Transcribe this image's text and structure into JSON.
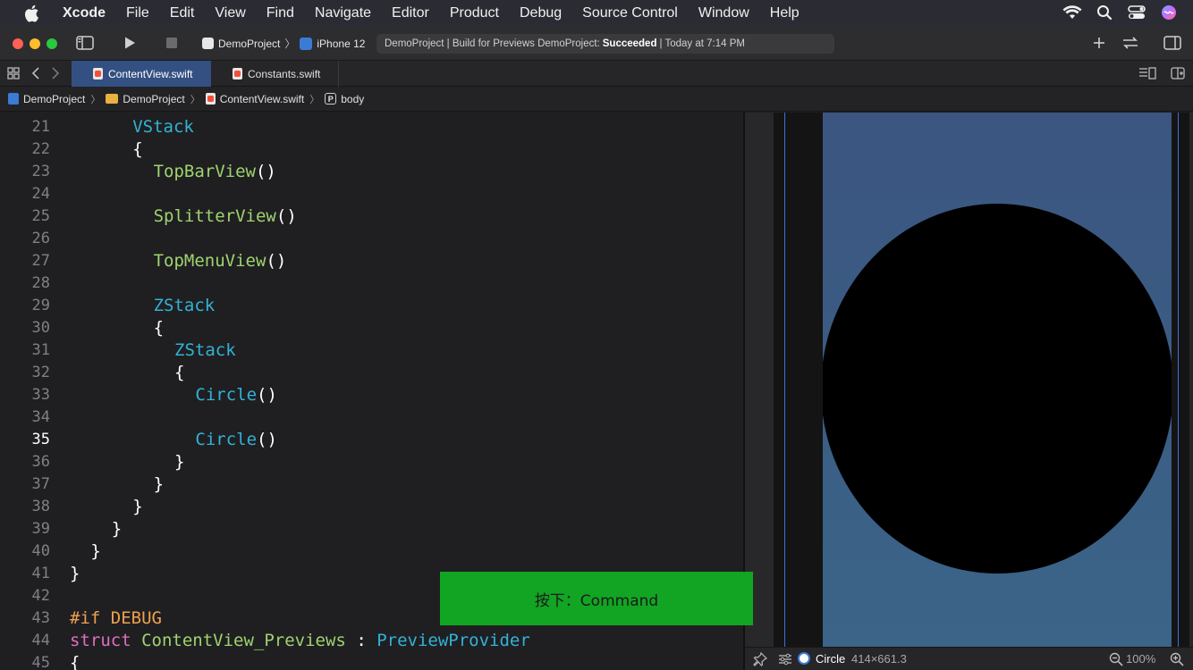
{
  "menubar": {
    "app_name": "Xcode",
    "items": [
      "File",
      "Edit",
      "View",
      "Find",
      "Navigate",
      "Editor",
      "Product",
      "Debug",
      "Source Control",
      "Window",
      "Help"
    ],
    "status_icons": [
      "wifi-icon",
      "search-icon",
      "control-center-icon",
      "siri-icon"
    ]
  },
  "toolbar": {
    "scheme": "DemoProject",
    "device": "iPhone 12",
    "status_prefix": "DemoProject | Build for Previews DemoProject:",
    "status_result": "Succeeded",
    "status_suffix": "| Today at 7:14 PM"
  },
  "tabs": [
    {
      "label": "ContentView.swift",
      "active": true
    },
    {
      "label": "Constants.swift",
      "active": false
    }
  ],
  "breadcrumb": [
    "DemoProject",
    "DemoProject",
    "ContentView.swift",
    "body"
  ],
  "editor": {
    "current_line": 35,
    "lines": [
      {
        "n": "21",
        "indent": 6,
        "tokens": [
          [
            "type",
            "VStack"
          ]
        ]
      },
      {
        "n": "22",
        "indent": 6,
        "tokens": [
          [
            "plain",
            "{"
          ]
        ]
      },
      {
        "n": "23",
        "indent": 8,
        "tokens": [
          [
            "call",
            "TopBarView"
          ],
          [
            "plain",
            "()"
          ]
        ]
      },
      {
        "n": "24",
        "indent": 0,
        "tokens": []
      },
      {
        "n": "25",
        "indent": 8,
        "tokens": [
          [
            "call",
            "SplitterView"
          ],
          [
            "plain",
            "()"
          ]
        ]
      },
      {
        "n": "26",
        "indent": 0,
        "tokens": []
      },
      {
        "n": "27",
        "indent": 8,
        "tokens": [
          [
            "call",
            "TopMenuView"
          ],
          [
            "plain",
            "()"
          ]
        ]
      },
      {
        "n": "28",
        "indent": 0,
        "tokens": []
      },
      {
        "n": "29",
        "indent": 8,
        "tokens": [
          [
            "type",
            "ZStack"
          ]
        ]
      },
      {
        "n": "30",
        "indent": 8,
        "tokens": [
          [
            "plain",
            "{"
          ]
        ]
      },
      {
        "n": "31",
        "indent": 10,
        "tokens": [
          [
            "type",
            "ZStack"
          ]
        ]
      },
      {
        "n": "32",
        "indent": 10,
        "tokens": [
          [
            "plain",
            "{"
          ]
        ]
      },
      {
        "n": "33",
        "indent": 12,
        "tokens": [
          [
            "type",
            "Circle"
          ],
          [
            "plain",
            "()"
          ]
        ]
      },
      {
        "n": "34",
        "indent": 0,
        "tokens": []
      },
      {
        "n": "35",
        "indent": 12,
        "tokens": [
          [
            "type",
            "Circle"
          ],
          [
            "plain",
            "()"
          ]
        ]
      },
      {
        "n": "36",
        "indent": 10,
        "tokens": [
          [
            "plain",
            "}"
          ]
        ]
      },
      {
        "n": "37",
        "indent": 8,
        "tokens": [
          [
            "plain",
            "}"
          ]
        ]
      },
      {
        "n": "38",
        "indent": 6,
        "tokens": [
          [
            "plain",
            "}"
          ]
        ]
      },
      {
        "n": "39",
        "indent": 4,
        "tokens": [
          [
            "plain",
            "}"
          ]
        ]
      },
      {
        "n": "40",
        "indent": 2,
        "tokens": [
          [
            "plain",
            "}"
          ]
        ]
      },
      {
        "n": "41",
        "indent": 0,
        "tokens": [
          [
            "plain",
            "}"
          ]
        ]
      },
      {
        "n": "42",
        "indent": 0,
        "tokens": []
      },
      {
        "n": "43",
        "indent": 0,
        "tokens": [
          [
            "pre",
            "#if DEBUG"
          ]
        ]
      },
      {
        "n": "44",
        "indent": 0,
        "tokens": [
          [
            "kw",
            "struct"
          ],
          [
            "plain",
            " "
          ],
          [
            "call",
            "ContentView_Previews"
          ],
          [
            "plain",
            " : "
          ],
          [
            "type",
            "PreviewProvider"
          ]
        ]
      },
      {
        "n": "45",
        "indent": 0,
        "tokens": [
          [
            "plain",
            "{"
          ]
        ]
      }
    ]
  },
  "preview": {
    "selected_element": "Circle",
    "selected_size": "414×661.3",
    "zoom": "100%"
  },
  "key_overlay": {
    "text": "按下：Command"
  },
  "colors": {
    "accent_tab": "#345082",
    "overlay_green": "#11a523",
    "keyword_type": "#33b2d6",
    "keyword_call": "#9fd36f",
    "keyword_kw": "#e06ec0"
  }
}
